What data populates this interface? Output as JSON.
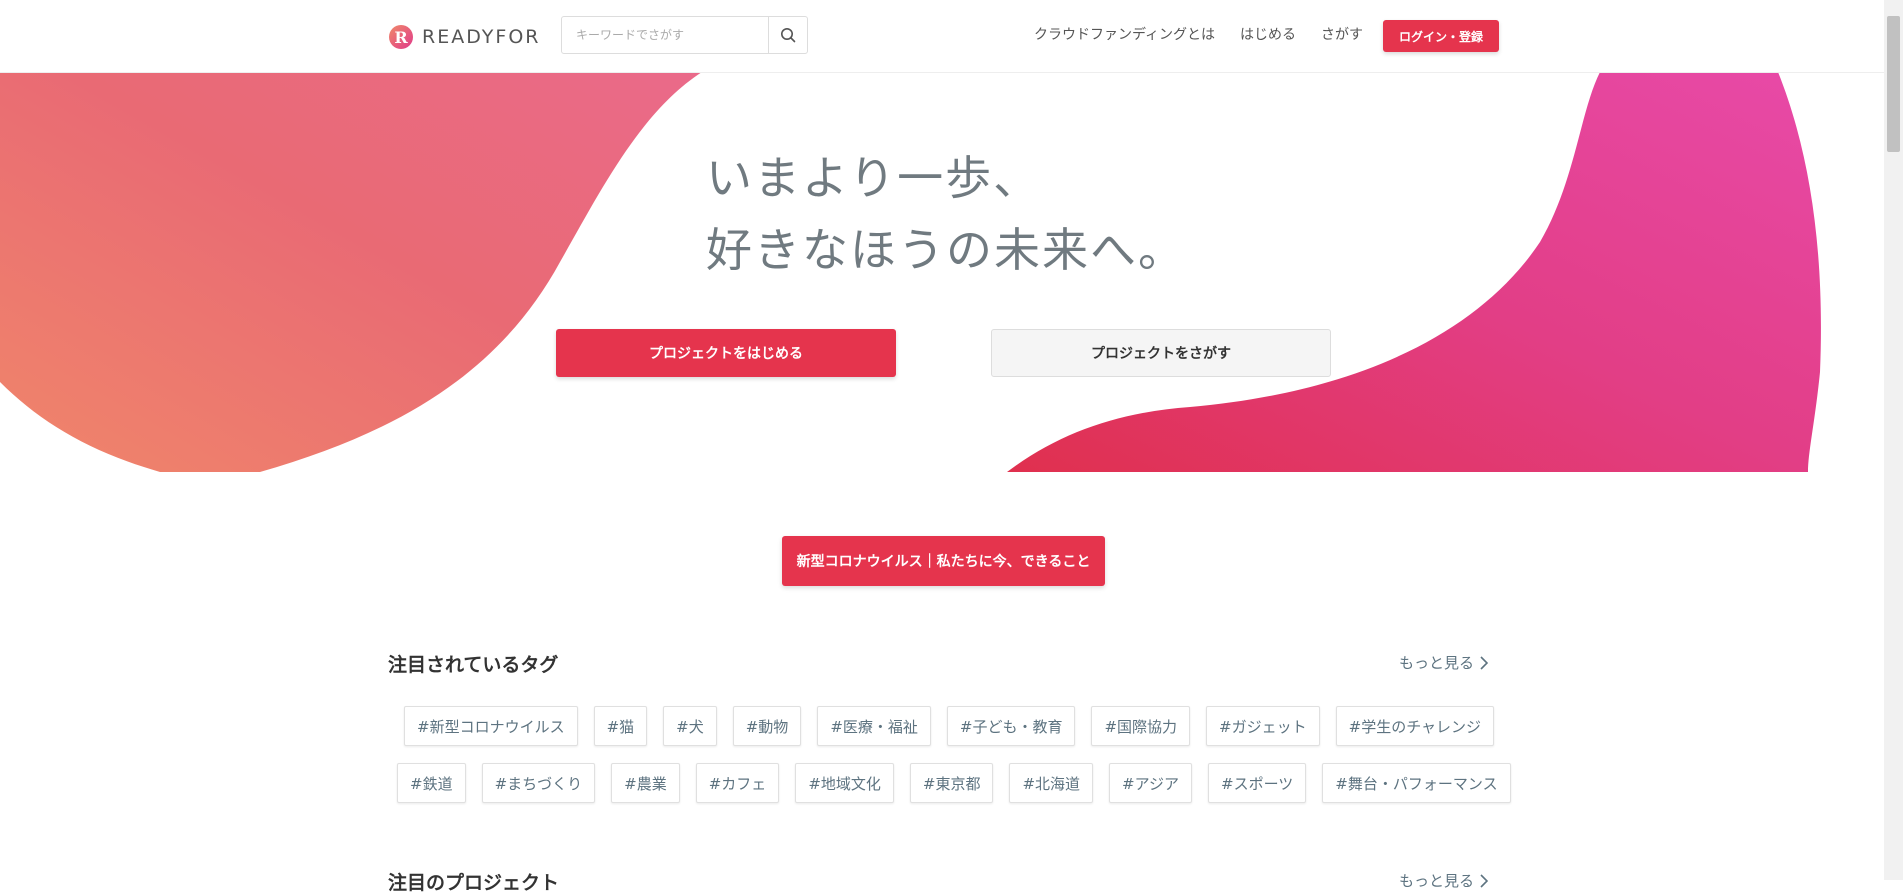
{
  "header": {
    "logo_text": "READYFOR",
    "search_placeholder": "キーワードでさがす",
    "nav": [
      {
        "label": "クラウドファンディングとは"
      },
      {
        "label": "はじめる"
      },
      {
        "label": "さがす"
      }
    ],
    "login_label": "ログイン・登録"
  },
  "hero": {
    "title_line1": "いまより一歩、",
    "title_line2": "好きなほうの未来へ。",
    "primary_label": "プロジェクトをはじめる",
    "secondary_label": "プロジェクトをさがす"
  },
  "corona_banner": {
    "label": "新型コロナウイルス｜私たちに今、できること"
  },
  "tags_section": {
    "title": "注目されているタグ",
    "more_label": "もっと見る",
    "row1": [
      "#新型コロナウイルス",
      "#猫",
      "#犬",
      "#動物",
      "#医療・福祉",
      "#子ども・教育",
      "#国際協力",
      "#ガジェット",
      "#学生のチャレンジ"
    ],
    "row2": [
      "#鉄道",
      "#まちづくり",
      "#農業",
      "#カフェ",
      "#地域文化",
      "#東京都",
      "#北海道",
      "#アジア",
      "#スポーツ",
      "#舞台・パフォーマンス"
    ]
  },
  "projects_section": {
    "title": "注目のプロジェクト",
    "more_label": "もっと見る"
  },
  "colors": {
    "brand": "#e5344d",
    "tag_text": "#5d7380",
    "hero_text": "#707a80"
  }
}
